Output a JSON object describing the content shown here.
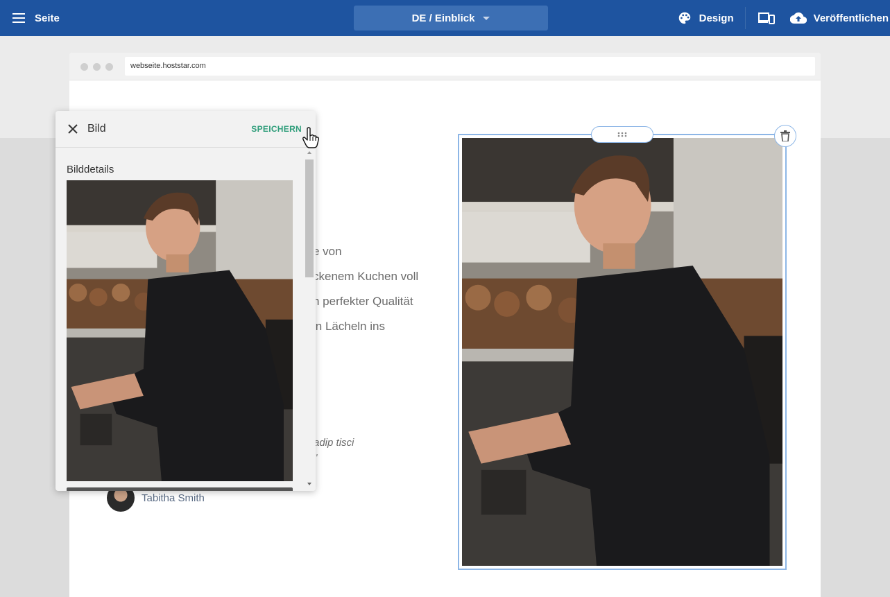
{
  "topbar": {
    "title": "Seite",
    "language_selector": "DE / Einblick",
    "design_label": "Design",
    "publish_label": "Veröffentlichen"
  },
  "browser": {
    "url": "webseite.hoststar.com"
  },
  "page_content": {
    "text_lines": [
      "e von",
      "ckenem Kuchen voll",
      "n perfekter Qualität",
      "in Lächeln ins"
    ],
    "quote": "adip tisci",
    "quote_mark": "\"",
    "author": "Tabitha Smith"
  },
  "panel": {
    "title": "Bild",
    "save_label": "SPEICHERN",
    "section_title": "Bilddetails"
  },
  "colors": {
    "topbar": "#1e54a0",
    "accent_green": "#2e9d7a",
    "selection": "#8db6e6"
  }
}
